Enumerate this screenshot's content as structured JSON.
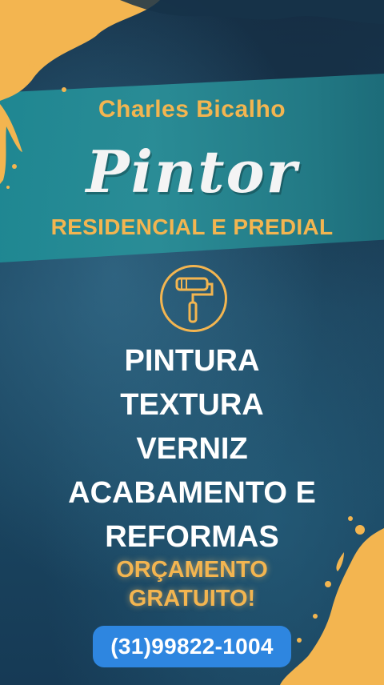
{
  "header": {
    "name": "Charles Bicalho",
    "title": "Pintor",
    "subtitle": "RESIDENCIAL E PREDIAL"
  },
  "icon": "paint-roller-icon",
  "services": [
    "PINTURA",
    "TEXTURA",
    "VERNIZ",
    "ACABAMENTO E",
    "REFORMAS"
  ],
  "quote": {
    "line1": "ORÇAMENTO",
    "line2": "GRATUITO!"
  },
  "contact": {
    "phone": "(31)99822-1004"
  },
  "colors": {
    "accent": "#f3b550",
    "background": "#1d3f5a",
    "band": "#1f8a94",
    "phone_button": "#2e86e0"
  }
}
